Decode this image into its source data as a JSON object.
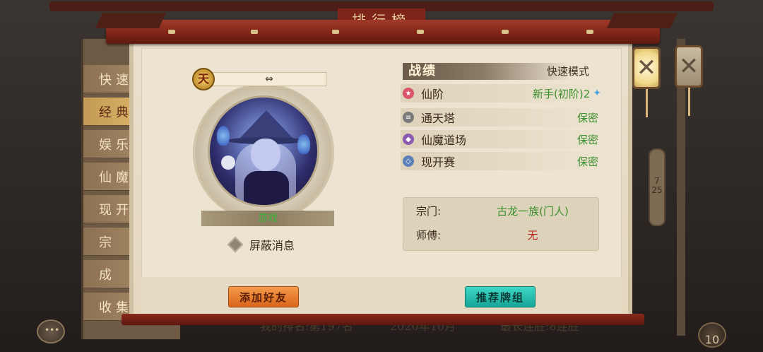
{
  "background": {
    "top_title": "排行榜",
    "tabs": [
      {
        "label": "快速",
        "active": false
      },
      {
        "label": "经典",
        "active": true
      },
      {
        "label": "娱乐",
        "active": false
      },
      {
        "label": "仙魔",
        "active": false
      },
      {
        "label": "现开",
        "active": false
      },
      {
        "label": "宗",
        "active": false
      },
      {
        "label": "成",
        "active": false
      },
      {
        "label": "收集",
        "active": false
      }
    ],
    "scroll_page": "7",
    "scroll_total": "25",
    "bottom_rank_text": "我的排名:第197名",
    "bottom_date_text": "2020年10月",
    "bottom_streak_text": "最长连胜:8连胜",
    "corner_badge": "10"
  },
  "lanterns": {
    "close_primary": "close-icon",
    "close_secondary": "close-icon",
    "glyph": "✕"
  },
  "player": {
    "rank_badge": "天",
    "name_bar": "⇔",
    "status": "游戏",
    "block_label": "屏蔽消息"
  },
  "record": {
    "title": "战绩",
    "mode": "快速模式",
    "stats": [
      {
        "icon": "star-icon",
        "color": "#d9546a",
        "glyph": "★",
        "label": "仙阶",
        "value": "新手(初阶)2",
        "badge": "✦"
      },
      {
        "icon": "tower-icon",
        "color": "#7a7a7a",
        "glyph": "≡",
        "label": "通天塔",
        "value": "保密"
      },
      {
        "icon": "arena-icon",
        "color": "#8a5ab0",
        "glyph": "◆",
        "label": "仙魔道场",
        "value": "保密"
      },
      {
        "icon": "open-match-icon",
        "color": "#5b7fb8",
        "glyph": "◇",
        "label": "现开赛",
        "value": "保密"
      }
    ],
    "sect_label": "宗门:",
    "sect_value": "古龙一族(门人)",
    "master_label": "师傅:",
    "master_value": "无"
  },
  "buttons": {
    "add_friend": "添加好友",
    "recommend_deck": "推荐牌组"
  },
  "colors": {
    "frame_red": "#7e2317",
    "paper": "#e9dfcb",
    "value_green": "#3b8f2e",
    "value_red": "#b3261e",
    "add_btn": "#e57b2e",
    "deck_btn": "#22b8a8"
  }
}
